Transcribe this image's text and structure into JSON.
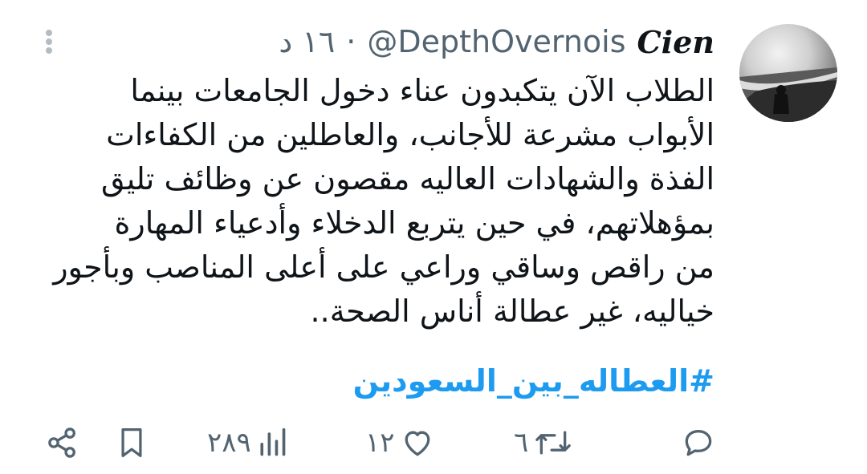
{
  "tweet": {
    "display_name": "Cien",
    "handle": "@DepthOvernois",
    "separator": "·",
    "time": "١٦ د",
    "text_lines": [
      "الطلاب الآن يتكبدون عناء دخول الجامعات بينما",
      "الأبواب مشرعة للأجانب، والعاطلين من الكفاءات",
      "الفذة والشهادات العاليه مقصون عن وظائف تليق",
      "بمؤهلاتهم، في حين يتربع الدخلاء وأدعياء المهارة",
      "من راقص وساقي وراعي على أعلى المناصب وبأجور",
      "خياليه، غير عطالة أناس الصحة.."
    ],
    "hashtag": "#العطاله_بين_السعودين"
  },
  "actions": {
    "replies": "",
    "retweets": "٦",
    "likes": "١٢",
    "views": "٢٨٩"
  },
  "icons": [
    "more-icon",
    "reply-icon",
    "retweet-icon",
    "like-icon",
    "views-icon",
    "bookmark-icon",
    "share-icon"
  ],
  "colors": {
    "text": "#0f1419",
    "secondary": "#536471",
    "hashtag": "#1d9bf0",
    "background": "#ffffff"
  }
}
